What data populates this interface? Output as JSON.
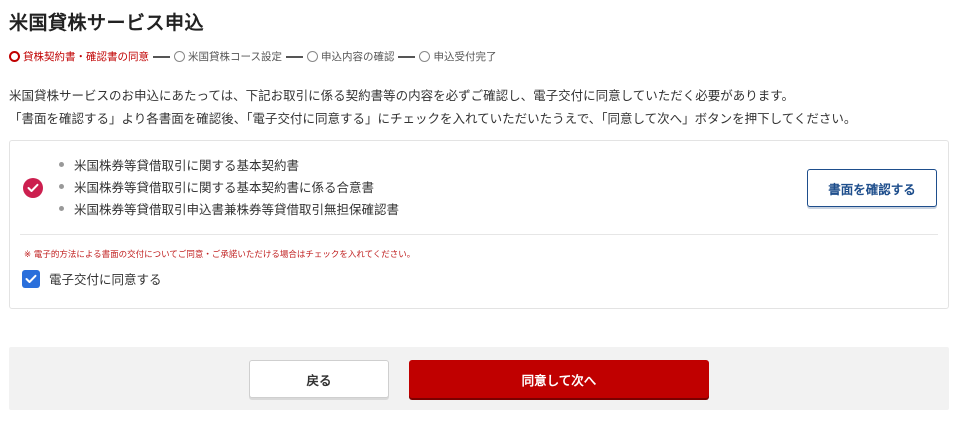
{
  "page": {
    "title": "米国貸株サービス申込"
  },
  "stepper": {
    "steps": [
      {
        "label": "貸株契約書・確認書の同意",
        "active": true
      },
      {
        "label": "米国貸株コース設定",
        "active": false
      },
      {
        "label": "申込内容の確認",
        "active": false
      },
      {
        "label": "申込受付完了",
        "active": false
      }
    ]
  },
  "intro": {
    "line1": "米国貸株サービスのお申込にあたっては、下記お取引に係る契約書等の内容を必ずご確認し、電子交付に同意していただく必要があります。",
    "line2": "「書面を確認する」より各書面を確認後、「電子交付に同意する」にチェックを入れていただいたうえで、「同意して次へ」ボタンを押下してください。"
  },
  "documents": {
    "items": [
      "米国株券等貸借取引に関する基本契約書",
      "米国株券等貸借取引に関する基本契約書に係る合意書",
      "米国株券等貸借取引申込書兼株券等貸借取引無担保確認書"
    ],
    "confirmed": true,
    "confirm_button_label": "書面を確認する"
  },
  "consent": {
    "note": "※ 電子的方法による書面の交付についてご同意・ご承諾いただける場合はチェックを入れてください。",
    "checkbox_label": "電子交付に同意する",
    "checked": true
  },
  "footer": {
    "back_label": "戻る",
    "next_label": "同意して次へ"
  },
  "colors": {
    "accent_red": "#c00000",
    "confirmed_check": "#cc1f4f",
    "link_blue": "#1e4e8c",
    "checkbox_blue": "#2a6fdb"
  }
}
